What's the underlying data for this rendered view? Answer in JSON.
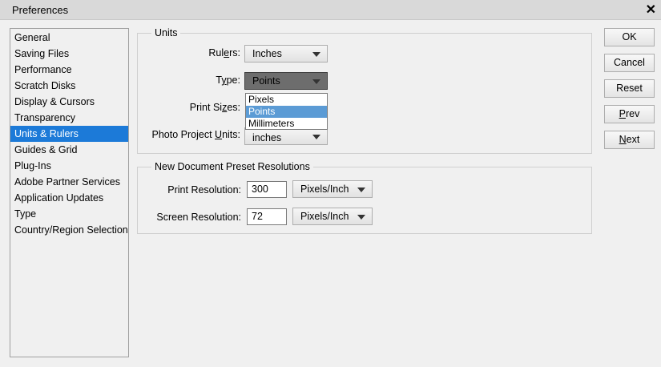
{
  "window": {
    "title": "Preferences",
    "close_glyph": "✕",
    "close_icon": "close-icon"
  },
  "sidebar": {
    "selected_index": 6,
    "items": [
      {
        "label": "General"
      },
      {
        "label": "Saving Files"
      },
      {
        "label": "Performance"
      },
      {
        "label": "Scratch Disks"
      },
      {
        "label": "Display & Cursors"
      },
      {
        "label": "Transparency"
      },
      {
        "label": "Units & Rulers"
      },
      {
        "label": "Guides & Grid"
      },
      {
        "label": "Plug-Ins"
      },
      {
        "label": "Adobe Partner Services"
      },
      {
        "label": "Application Updates"
      },
      {
        "label": "Type"
      },
      {
        "label": "Country/Region Selection"
      }
    ]
  },
  "units": {
    "legend": "Units",
    "rulers": {
      "label_pre": "Rul",
      "label_u": "e",
      "label_post": "rs:",
      "value": "Inches"
    },
    "type": {
      "label_pre": "T",
      "label_u": "y",
      "label_post": "pe:",
      "value": "Points",
      "options": [
        "Pixels",
        "Points",
        "Millimeters"
      ],
      "highlighted": "Points"
    },
    "print_sizes": {
      "label_pre": "Print Si",
      "label_u": "z",
      "label_post": "es:"
    },
    "photo_project_units": {
      "label_pre": "Photo Project ",
      "label_u": "U",
      "label_post": "nits:",
      "value": "inches"
    }
  },
  "resolutions": {
    "legend": "New Document Preset Resolutions",
    "print": {
      "label": "Print Resolution:",
      "value": "300",
      "unit": "Pixels/Inch"
    },
    "screen": {
      "label": "Screen Resolution:",
      "value": "72",
      "unit": "Pixels/Inch"
    }
  },
  "buttons": {
    "ok": "OK",
    "cancel": "Cancel",
    "reset": "Reset",
    "prev_u": "P",
    "prev_rest": "rev",
    "next_u": "N",
    "next_rest": "ext"
  },
  "colors": {
    "selection": "#1c7ad8",
    "dropdown_highlight": "#5b9bd5"
  }
}
